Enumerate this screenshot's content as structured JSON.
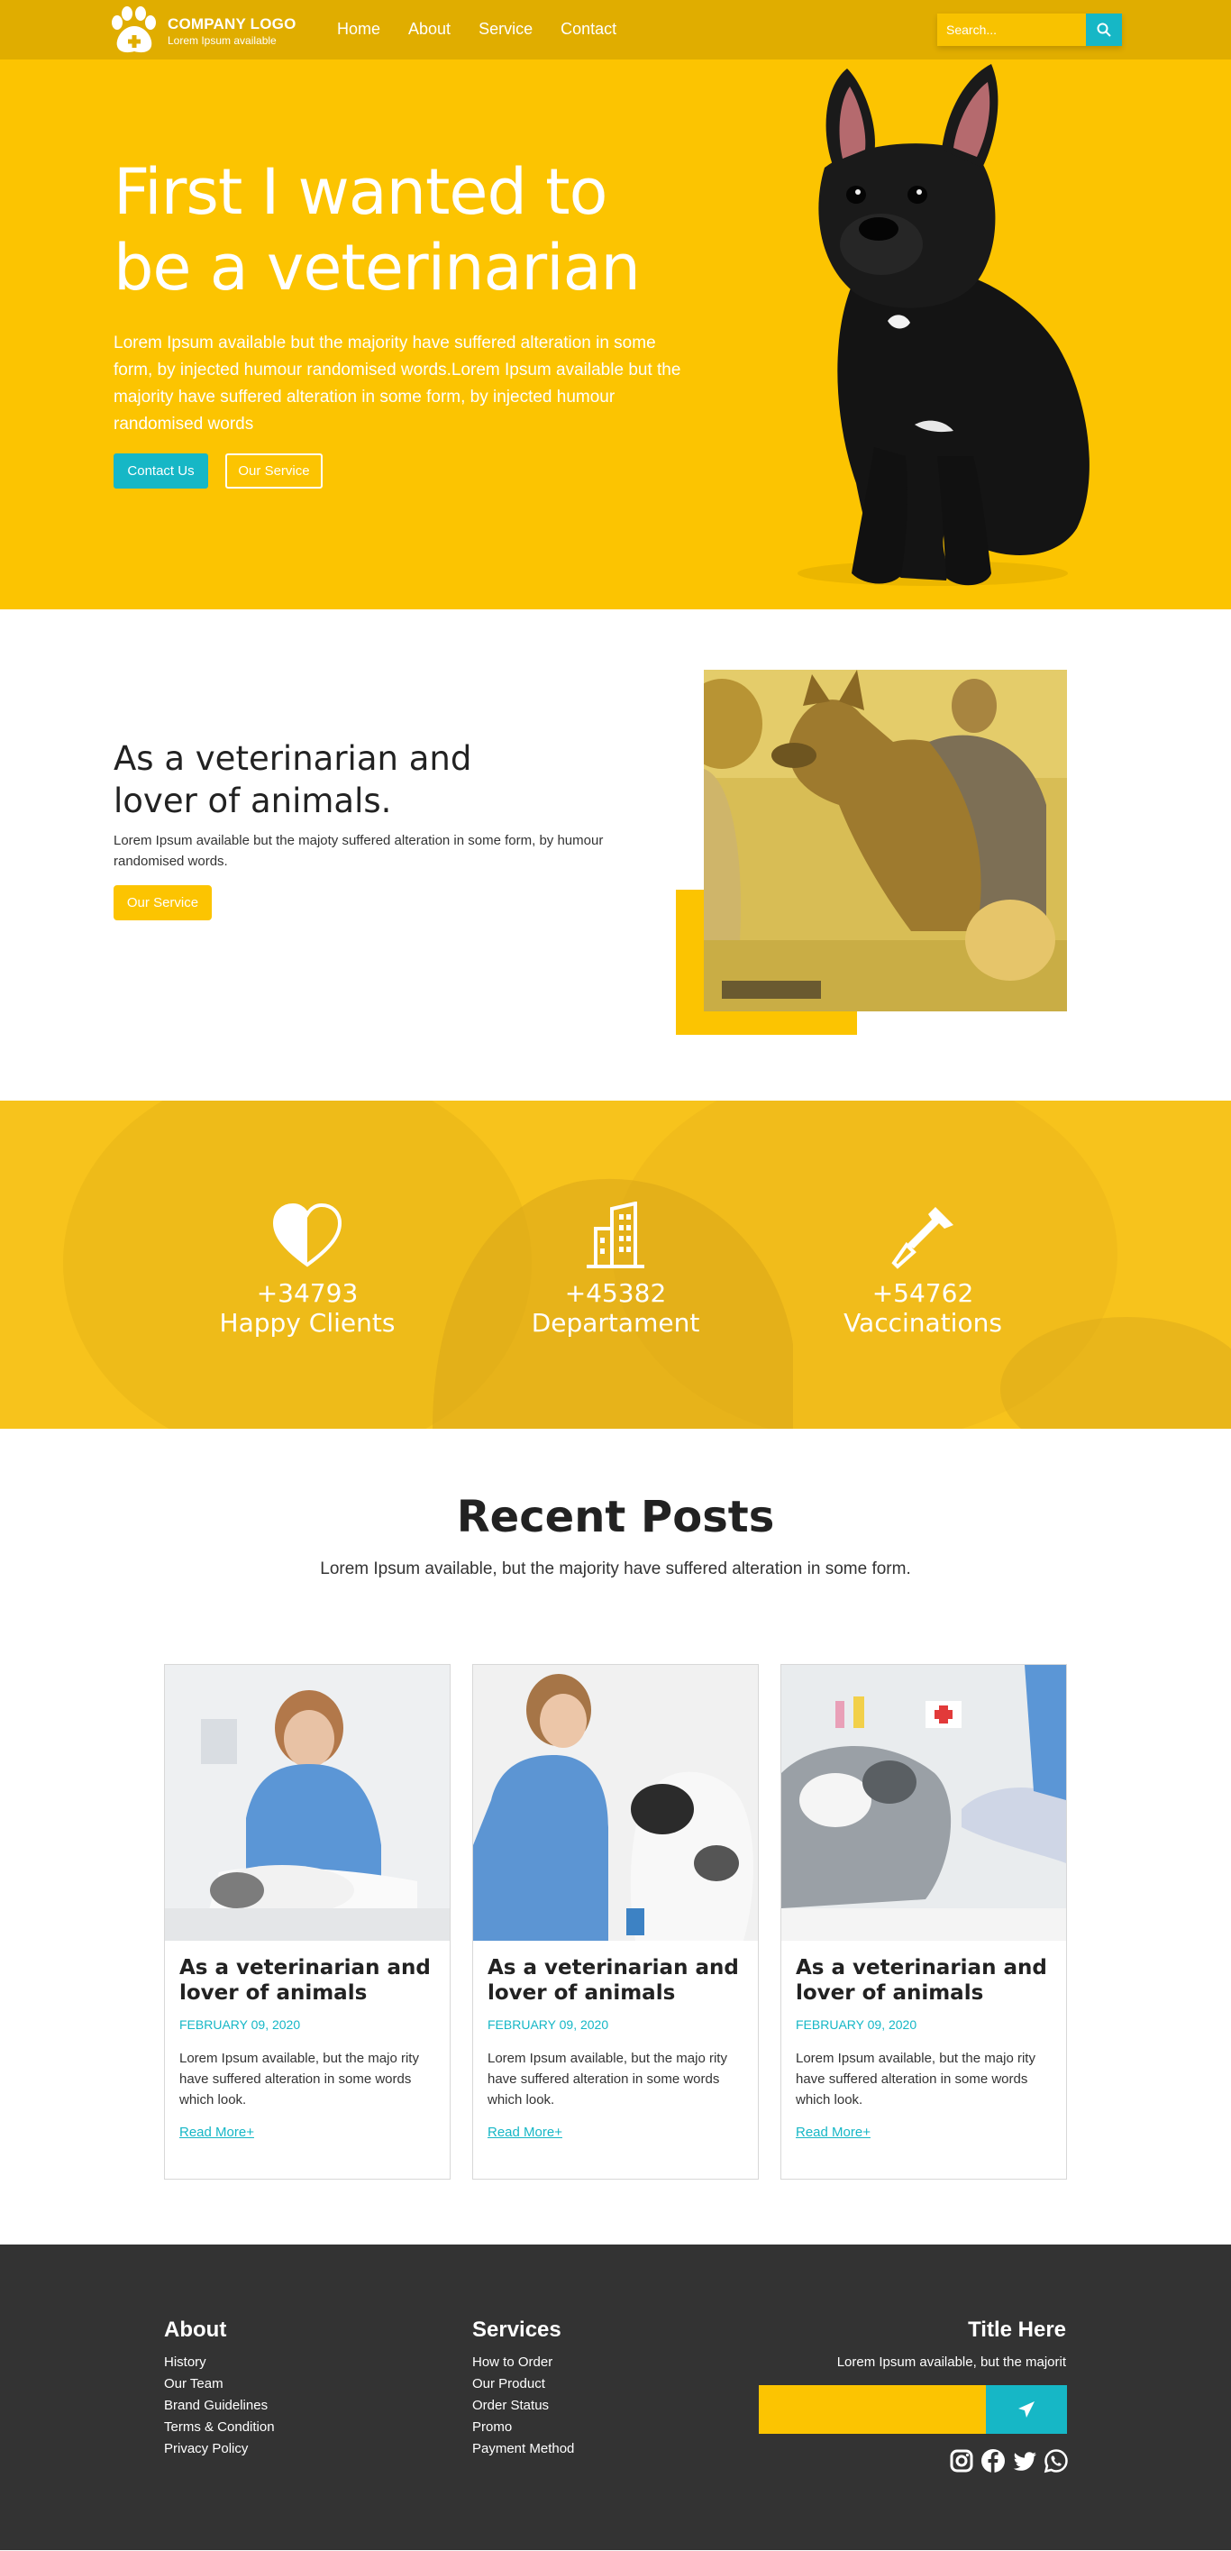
{
  "nav": {
    "logo_title": "COMPANY LOGO",
    "logo_subtitle": "Lorem Ipsum available",
    "menu": [
      "Home",
      "About",
      "Service",
      "Contact"
    ],
    "search_placeholder": "Search...",
    "colors": {
      "bar": "#e0ad00",
      "accent": "#16b7c6"
    }
  },
  "hero": {
    "title": "First I wanted to be a veterinarian",
    "text": "Lorem Ipsum available but the majority have suffered alteration in some form, by injected humour randomised words.Lorem Ipsum available but the majority have suffered alteration in some form, by injected humour randomised words",
    "button_primary": "Contact Us",
    "button_secondary": "Our Service",
    "background": "#fcc401"
  },
  "about": {
    "title": "As a veterinarian and lover of animals.",
    "text": "Lorem Ipsum available but the majoty suffered alteration in some form, by humour randomised words.",
    "button": "Our Service"
  },
  "stats": [
    {
      "icon": "heart-icon",
      "number": "+34793",
      "label": "Happy Clients"
    },
    {
      "icon": "building-icon",
      "number": "+45382",
      "label": "Departament"
    },
    {
      "icon": "syringe-icon",
      "number": "+54762",
      "label": "Vaccinations"
    }
  ],
  "posts": {
    "title": "Recent Posts",
    "subtitle": "Lorem Ipsum available, but the majority have suffered alteration in some form.",
    "cards": [
      {
        "title": "As a veterinarian and lover of animals",
        "date": "FEBRUARY 09, 2020",
        "text": "Lorem Ipsum available, but the majo rity have suffered alteration in some words which look.",
        "link": "Read More+"
      },
      {
        "title": "As a veterinarian and lover of animals",
        "date": "FEBRUARY 09, 2020",
        "text": "Lorem Ipsum available, but the majo rity have suffered alteration in some words which look.",
        "link": "Read More+"
      },
      {
        "title": "As a veterinarian and lover of animals",
        "date": "FEBRUARY 09, 2020",
        "text": "Lorem Ipsum available, but the majo rity have suffered alteration in some words which look.",
        "link": "Read More+"
      }
    ]
  },
  "footer": {
    "about_title": "About",
    "about_links": [
      "History",
      "Our Team",
      "Brand Guidelines",
      "Terms & Condition",
      "Privacy Policy"
    ],
    "services_title": "Services",
    "services_links": [
      "How to Order",
      "Our Product",
      "Order Status",
      "Promo",
      "Payment Method"
    ],
    "right_title": "Title Here",
    "right_text": "Lorem Ipsum available, but the majorit",
    "social": [
      "instagram-icon",
      "facebook-icon",
      "twitter-icon",
      "whatsapp-icon"
    ]
  }
}
